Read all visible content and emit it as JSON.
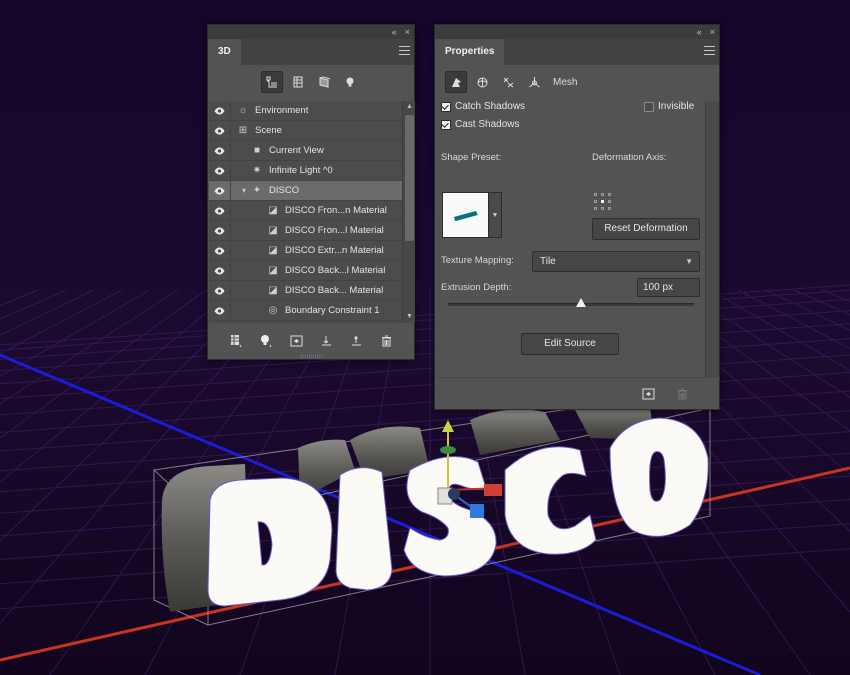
{
  "colors": {
    "panel_bg": "#535353",
    "panel_dark": "#424242",
    "background": "#1a0a2a",
    "grid_line": "#3a1d5e",
    "axis_blue": "#1c1cd8",
    "axis_red": "#c8341e"
  },
  "panel3d": {
    "tab": "3D",
    "collapse_icon": "«",
    "close_icon": "×",
    "filters": [
      {
        "name": "scene-filter-icon"
      },
      {
        "name": "meshes-filter-icon"
      },
      {
        "name": "materials-filter-icon"
      },
      {
        "name": "lights-filter-icon"
      }
    ],
    "layers": [
      {
        "label": "Environment",
        "icon": "environment-icon",
        "glyph": "☼",
        "indent": 0
      },
      {
        "label": "Scene",
        "icon": "scene-icon",
        "glyph": "⊞",
        "indent": 0
      },
      {
        "label": "Current View",
        "icon": "camera-icon",
        "glyph": "■",
        "indent": 1
      },
      {
        "label": "Infinite Light ^0",
        "icon": "light-icon",
        "glyph": "✷",
        "indent": 1
      },
      {
        "label": "DISCO",
        "icon": "mesh-icon",
        "glyph": "✦",
        "indent": 1
      },
      {
        "label": "DISCO Fron...n Material",
        "icon": "material-icon",
        "glyph": "◪",
        "indent": 2
      },
      {
        "label": "DISCO Fron...l Material",
        "icon": "material-icon",
        "glyph": "◪",
        "indent": 2
      },
      {
        "label": "DISCO Extr...n Material",
        "icon": "material-icon",
        "glyph": "◪",
        "indent": 2
      },
      {
        "label": "DISCO Back...l Material",
        "icon": "material-icon",
        "glyph": "◪",
        "indent": 2
      },
      {
        "label": "DISCO Back... Material",
        "icon": "material-icon",
        "glyph": "◪",
        "indent": 2
      },
      {
        "label": "Boundary Constraint 1",
        "icon": "constraint-icon",
        "glyph": "◎",
        "indent": 2
      }
    ],
    "toolbar": [
      {
        "name": "new-mesh-icon",
        "glyph": "▦"
      },
      {
        "name": "new-light-icon",
        "glyph": "●"
      },
      {
        "name": "render-icon",
        "glyph": "⧉"
      },
      {
        "name": "ground-plane-icon",
        "glyph": "⊥"
      },
      {
        "name": "drop-to-plane-icon",
        "glyph": "⊥"
      },
      {
        "name": "trash-icon",
        "glyph": "🗑"
      }
    ]
  },
  "properties": {
    "tab": "Properties",
    "collapse_icon": "«",
    "close_icon": "×",
    "mesh_label": "Mesh",
    "catch_shadows": "Catch Shadows",
    "cast_shadows": "Cast Shadows",
    "invisible": "Invisible",
    "catch_shadows_checked": true,
    "cast_shadows_checked": true,
    "invisible_checked": false,
    "shape_preset_label": "Shape Preset:",
    "deformation_axis_label": "Deformation Axis:",
    "reset_deformation": "Reset Deformation",
    "texture_mapping_label": "Texture Mapping:",
    "texture_mapping_value": "Tile",
    "extrusion_depth_label": "Extrusion Depth:",
    "extrusion_depth_value": "100 px",
    "extrusion_slider_fraction": 0.54,
    "edit_source": "Edit Source"
  },
  "canvas": {
    "text": "DISCO"
  }
}
